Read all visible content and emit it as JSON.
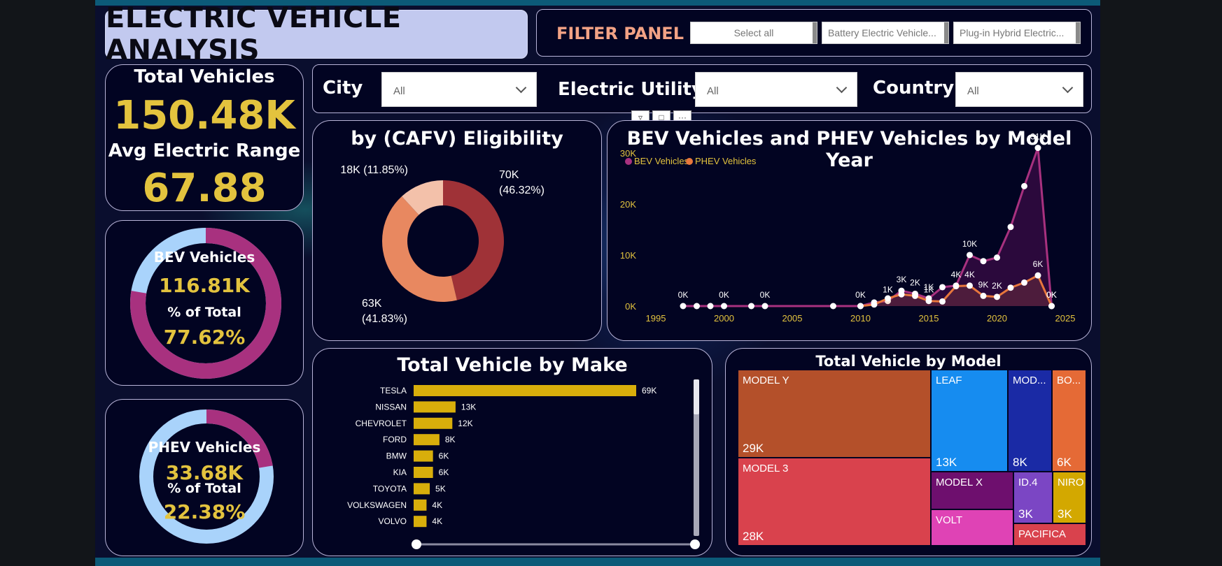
{
  "header": {
    "title": "ELECTRIC VEHICLE ANALYSIS"
  },
  "filter_panel": {
    "label": "FILTER PANEL",
    "chips": [
      "Select all",
      "Battery Electric Vehicle...",
      "Plug-in Hybrid Electric..."
    ]
  },
  "filters": [
    {
      "label": "City",
      "value": "All"
    },
    {
      "label": "Electric Utility",
      "value": "All"
    },
    {
      "label": "Country",
      "value": "All"
    }
  ],
  "kpis": {
    "total_label": "Total Vehicles",
    "total_value": "150.48K",
    "range_label": "Avg Electric Range",
    "range_value": "67.88",
    "bev_label": "BEV Vehicles",
    "bev_value": "116.81K",
    "bev_pct_label": "% of Total",
    "bev_pct": "77.62%",
    "bev_fraction": 0.7762,
    "phev_label": "PHEV Vehicles",
    "phev_value": "33.68K",
    "phev_pct_label": "% of Total",
    "phev_pct": "22.38%",
    "phev_fraction": 0.2238
  },
  "colors": {
    "accent_gold": "#e3c33e",
    "bev": "#a8317f",
    "phev": "#e8773c",
    "ring_light": "#a9d3fb"
  },
  "chart_data": [
    {
      "type": "pie",
      "title": "by (CAFV) Eligibility",
      "slices": [
        {
          "label": "70K (46.32%)",
          "value": 46.32,
          "color": "#9f3237"
        },
        {
          "label": "63K (41.83%)",
          "value": 41.83,
          "color": "#e88860"
        },
        {
          "label": "18K (11.85%)",
          "value": 11.85,
          "color": "#f3c1aa"
        }
      ]
    },
    {
      "type": "area",
      "title": "BEV Vehicles and PHEV Vehicles by Model Year",
      "legend": [
        "BEV Vehicles",
        "PHEV Vehicles"
      ],
      "xlim": [
        1995,
        2025
      ],
      "ylim": [
        0,
        33000
      ],
      "x_ticks": [
        "1995",
        "2000",
        "2005",
        "2010",
        "2015",
        "2020",
        "2025"
      ],
      "y_ticks": [
        "0K",
        "10K",
        "20K",
        "30K"
      ],
      "series": [
        {
          "name": "BEV Vehicles",
          "color": "#a8317f",
          "points": [
            [
              1997,
              0
            ],
            [
              1998,
              0
            ],
            [
              1999,
              0
            ],
            [
              2000,
              0
            ],
            [
              2002,
              0
            ],
            [
              2003,
              0
            ],
            [
              2008,
              0
            ],
            [
              2010,
              0
            ],
            [
              2011,
              700
            ],
            [
              2012,
              1000
            ],
            [
              2013,
              3000
            ],
            [
              2014,
              2400
            ],
            [
              2015,
              1500
            ],
            [
              2016,
              3700
            ],
            [
              2017,
              4000
            ],
            [
              2018,
              10000
            ],
            [
              2019,
              8800
            ],
            [
              2020,
              9500
            ],
            [
              2021,
              15500
            ],
            [
              2022,
              23500
            ],
            [
              2023,
              31000
            ],
            [
              2024,
              0
            ]
          ]
        },
        {
          "name": "PHEV Vehicles",
          "color": "#e8773c",
          "points": [
            [
              2010,
              0
            ],
            [
              2011,
              300
            ],
            [
              2012,
              1500
            ],
            [
              2013,
              2300
            ],
            [
              2014,
              2000
            ],
            [
              2015,
              1000
            ],
            [
              2016,
              900
            ],
            [
              2017,
              3900
            ],
            [
              2018,
              4000
            ],
            [
              2019,
              2000
            ],
            [
              2020,
              1800
            ],
            [
              2021,
              3600
            ],
            [
              2022,
              4600
            ],
            [
              2023,
              6000
            ],
            [
              2024,
              0
            ]
          ]
        }
      ],
      "data_labels": [
        {
          "text": "0K",
          "x": 1997,
          "y": 0
        },
        {
          "text": "0K",
          "x": 2000,
          "y": 0
        },
        {
          "text": "0K",
          "x": 2003,
          "y": 0
        },
        {
          "text": "0K",
          "x": 2010,
          "y": 0
        },
        {
          "text": "1K",
          "x": 2012,
          "y": 1000
        },
        {
          "text": "3K",
          "x": 2013,
          "y": 3000
        },
        {
          "text": "2K",
          "x": 2014,
          "y": 2400
        },
        {
          "text": "1K",
          "x": 2015,
          "y": 1500
        },
        {
          "text": "1K",
          "x": 2015,
          "y": 1000
        },
        {
          "text": "4K",
          "x": 2017,
          "y": 4000
        },
        {
          "text": "4K",
          "x": 2018,
          "y": 4000
        },
        {
          "text": "10K",
          "x": 2018,
          "y": 10000
        },
        {
          "text": "9K",
          "x": 2019,
          "y": 2000
        },
        {
          "text": "2K",
          "x": 2020,
          "y": 1800
        },
        {
          "text": "6K",
          "x": 2023,
          "y": 6000
        },
        {
          "text": "31K",
          "x": 2023,
          "y": 31000
        },
        {
          "text": "0K",
          "x": 2024,
          "y": 0
        },
        {
          "text": "0K",
          "x": 2024,
          "y": 0
        }
      ]
    },
    {
      "type": "bar",
      "title": "Total Vehicle by Make",
      "orientation": "horizontal",
      "color": "#d8ae0b",
      "categories": [
        "TESLA",
        "NISSAN",
        "CHEVROLET",
        "FORD",
        "BMW",
        "KIA",
        "TOYOTA",
        "VOLKSWAGEN",
        "VOLVO"
      ],
      "values": [
        69000,
        13000,
        12000,
        8000,
        6000,
        6000,
        5000,
        4000,
        4000
      ],
      "labels": [
        "69K",
        "13K",
        "12K",
        "8K",
        "6K",
        "6K",
        "5K",
        "4K",
        "4K"
      ]
    },
    {
      "type": "treemap",
      "title": "Total Vehicle by Model",
      "cells": [
        {
          "name": "MODEL Y",
          "label": "29K",
          "color": "#b4502a"
        },
        {
          "name": "MODEL 3",
          "label": "28K",
          "color": "#d9424d"
        },
        {
          "name": "LEAF",
          "label": "13K",
          "color": "#168cf0"
        },
        {
          "name": "MOD...",
          "label": "8K",
          "color": "#1a2aa5"
        },
        {
          "name": "BO...",
          "label": "6K",
          "color": "#e56a36"
        },
        {
          "name": "MODEL X",
          "label": "",
          "color": "#6e0f6e"
        },
        {
          "name": "VOLT",
          "label": "",
          "color": "#df43b5"
        },
        {
          "name": "ID.4",
          "label": "3K",
          "color": "#7b46c4"
        },
        {
          "name": "NIRO",
          "label": "3K",
          "color": "#d3a800"
        },
        {
          "name": "PACIFICA",
          "label": "",
          "color": "#d9424d"
        }
      ]
    }
  ]
}
